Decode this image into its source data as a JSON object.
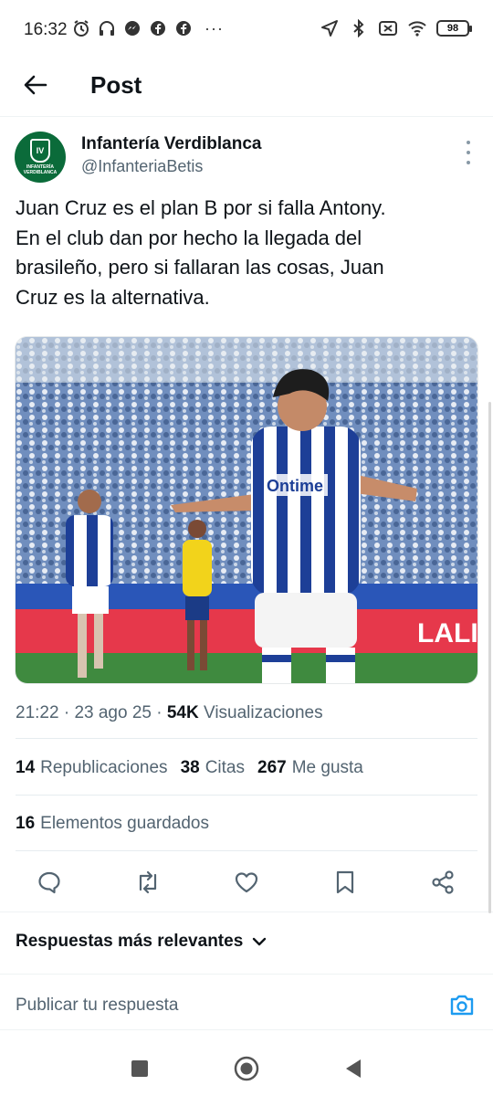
{
  "status_bar": {
    "time": "16:32",
    "left_icons": [
      "alarm-icon",
      "headphones-icon",
      "messenger-icon",
      "facebook-icon",
      "facebook-icon"
    ],
    "more": "···",
    "right_icons": [
      "location-icon",
      "bluetooth-icon",
      "sim-off-icon",
      "wifi-icon"
    ],
    "battery": "98"
  },
  "header": {
    "back_icon": "arrow-left-icon",
    "title": "Post"
  },
  "post": {
    "author_name": "Infantería Verdiblanca",
    "author_handle": "@InfanteriaBetis",
    "avatar_text": "INFANTERÍA VERDIBLANCA",
    "text": "Juan Cruz es el plan B por si falla Antony.\nEn el club dan por hecho la llegada del\nbrasileño, pero si fallaran las cosas, Juan\nCruz es la alternativa.",
    "image_jersey_text": "Ontime",
    "image_board_text": "LALI",
    "time": "21:22",
    "date": "23 ago 25",
    "views_count": "54K",
    "views_label": "Visualizaciones",
    "reposts_count": "14",
    "reposts_label": "Republicaciones",
    "quotes_count": "38",
    "quotes_label": "Citas",
    "likes_count": "267",
    "likes_label": "Me gusta",
    "bookmarks_count": "16",
    "bookmarks_label": "Elementos guardados"
  },
  "actions": [
    "reply-icon",
    "repost-icon",
    "like-icon",
    "bookmark-icon",
    "share-icon"
  ],
  "replies": {
    "sort_label": "Respuestas más relevantes",
    "input_placeholder": "Publicar tu respuesta"
  },
  "colors": {
    "text_primary": "#0f1419",
    "text_secondary": "#536471",
    "accent": "#1d9bf0",
    "avatar_green": "#0b6b3a"
  }
}
